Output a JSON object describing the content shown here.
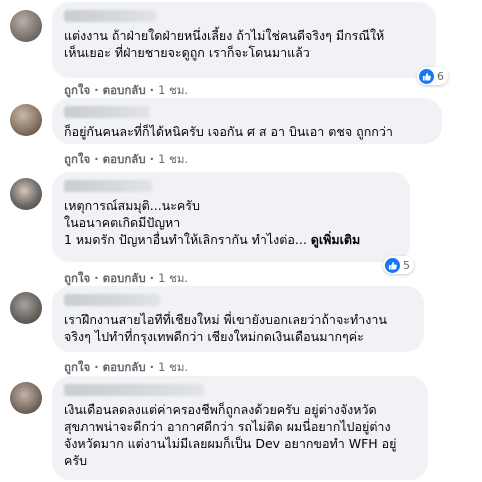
{
  "comments": [
    {
      "lines": [
        "แต่งงาน ถ้าฝ่ายใดฝ่ายหนึ่งเลี้ยง ถ้าไม่ใช่คนดีจริงๆ มีกรณีให้",
        "เห็นเยอะ ที่ฝ่ายชายจะดูถูก เราก็จะโดนมาแล้ว"
      ],
      "like_label": "ถูกใจ",
      "reply_label": "ตอบกลับ",
      "time": "1 ชม.",
      "reaction_count": "6",
      "reaction_icon": "like-icon"
    },
    {
      "lines": [
        "ก็อยู่กันคนละที่ก็ได้หนิครับ เจอกัน ศ ส อา บินเอา ตชจ ถูกกว่า"
      ],
      "like_label": "ถูกใจ",
      "reply_label": "ตอบกลับ",
      "time": "1 ชม."
    },
    {
      "lines": [
        "เหตุการณ์สมมุติ...นะครับ",
        "ในอนาคตเกิดมีปัญหา",
        "1 หมดรัก ปัญหาอื่นทำให้เลิกรากัน ทำไงต่อ..."
      ],
      "see_more": "ดูเพิ่มเติม",
      "like_label": "ถูกใจ",
      "reply_label": "ตอบกลับ",
      "time": "1 ชม.",
      "reaction_count": "5",
      "reaction_icon": "like-icon"
    },
    {
      "lines": [
        "เราฝึกงานสายไอทีที่เชียงใหม่ พี่เขายังบอกเลยว่าถ้าจะทำงาน",
        "จริงๆ ไปทำที่กรุงเทพดีกว่า เชียงใหม่กดเงินเดือนมากๆค่ะ"
      ],
      "like_label": "ถูกใจ",
      "reply_label": "ตอบกลับ",
      "time": "1 ชม."
    },
    {
      "lines": [
        "เงินเดือนลดลงแต่ค่าครองชีพก็ถูกลงด้วยครับ อยู่ต่างจังหวัด",
        "สุขภาพน่าจะดีกว่า อากาศดีกว่า รถไม่ติด ผมนี่อยากไปอยู่ต่าง",
        "จังหวัดมาก แต่งานไม่มีเลยผมก็เป็น Dev อยากขอทำ WFH อยู่",
        "ครับ"
      ]
    }
  ],
  "colors": {
    "bubble": "#f0f2f5",
    "meta": "#65676b",
    "like_blue": "#1877f2"
  }
}
